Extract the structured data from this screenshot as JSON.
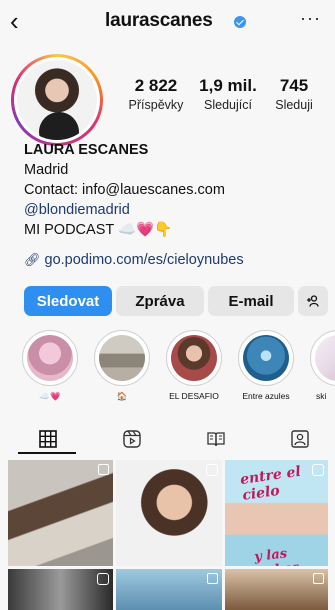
{
  "header": {
    "back_icon": "chevron-left-icon",
    "username": "laurascanes",
    "verified": true,
    "more_icon": "more-horizontal-icon"
  },
  "stats": {
    "posts_value": "2 822",
    "posts_label": "Příspěvky",
    "followers_value": "1,9 mil.",
    "followers_label": "Sledující",
    "following_value": "745",
    "following_label": "Sleduji"
  },
  "bio": {
    "name": "LAURA ESCANES",
    "line1": "Madrid",
    "line2": "Contact: info@lauescanes.com",
    "line3": "@blondiemadrid",
    "line4": "MI PODCAST ☁️💗👇",
    "link": "go.podimo.com/es/cieloynubes"
  },
  "buttons": {
    "follow": "Sledovat",
    "message": "Zpráva",
    "email": "E-mail",
    "suggest": "+ዹ"
  },
  "highlights": [
    {
      "label": "☁️💗",
      "color": "#c98fa8"
    },
    {
      "label": "🏠",
      "color": "#a9a49a"
    },
    {
      "label": "EL DESAFIO",
      "color": "#7b5c4a"
    },
    {
      "label": "Entre azules",
      "color": "#3e86b8"
    },
    {
      "label": "ski",
      "color": "#e7d9e6"
    }
  ],
  "tabs": [
    {
      "icon": "grid-icon",
      "active": true
    },
    {
      "icon": "reels-icon",
      "active": false
    },
    {
      "icon": "guides-icon",
      "active": false
    },
    {
      "icon": "tagged-icon",
      "active": false
    }
  ],
  "grid": {
    "cell3_title_top": "entre el cielo",
    "cell3_title_bottom": "y las nubes"
  },
  "colors": {
    "accent": "#2f8ff0",
    "link": "#1e3a6e",
    "verified": "#3b96f0"
  }
}
